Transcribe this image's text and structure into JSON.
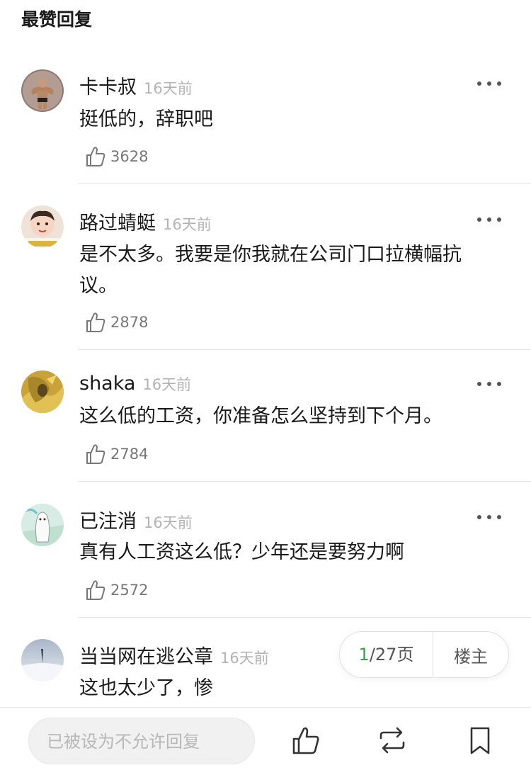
{
  "section_title": "最赞回复",
  "comments": [
    {
      "name": "卡卡叔",
      "time": "16天前",
      "text": "挺低的，辞职吧",
      "likes": "3628",
      "avatar": "bodybuilder-avatar"
    },
    {
      "name": "路过蜻蜓",
      "time": "16天前",
      "text": "是不太多。我要是你我就在公司门口拉横幅抗议。",
      "likes": "2878",
      "avatar": "baby-avatar"
    },
    {
      "name": "shaka",
      "time": "16天前",
      "text": "这么低的工资，你准备怎么坚持到下个月。",
      "likes": "2784",
      "avatar": "golden-figure-avatar"
    },
    {
      "name": "已注消",
      "time": "16天前",
      "text": "真有人工资这么低？少年还是要努力啊",
      "likes": "2572",
      "avatar": "cartoon-ghost-avatar"
    },
    {
      "name": "当当网在逃公章",
      "time": "16天前",
      "text": "这也太少了，惨",
      "likes": "",
      "avatar": "sky-avatar"
    }
  ],
  "pager": {
    "current": "1",
    "total_text": "/27页",
    "op_label": "楼主"
  },
  "bottom_bar": {
    "reply_placeholder": "已被设为不允许回复"
  },
  "icons": {
    "like": "thumbs-up-icon",
    "repost": "repost-icon",
    "bookmark": "bookmark-icon",
    "more": "more-dots-icon"
  },
  "colors": {
    "accent_green": "#3aa14a",
    "muted_text": "#b3b3b3"
  }
}
